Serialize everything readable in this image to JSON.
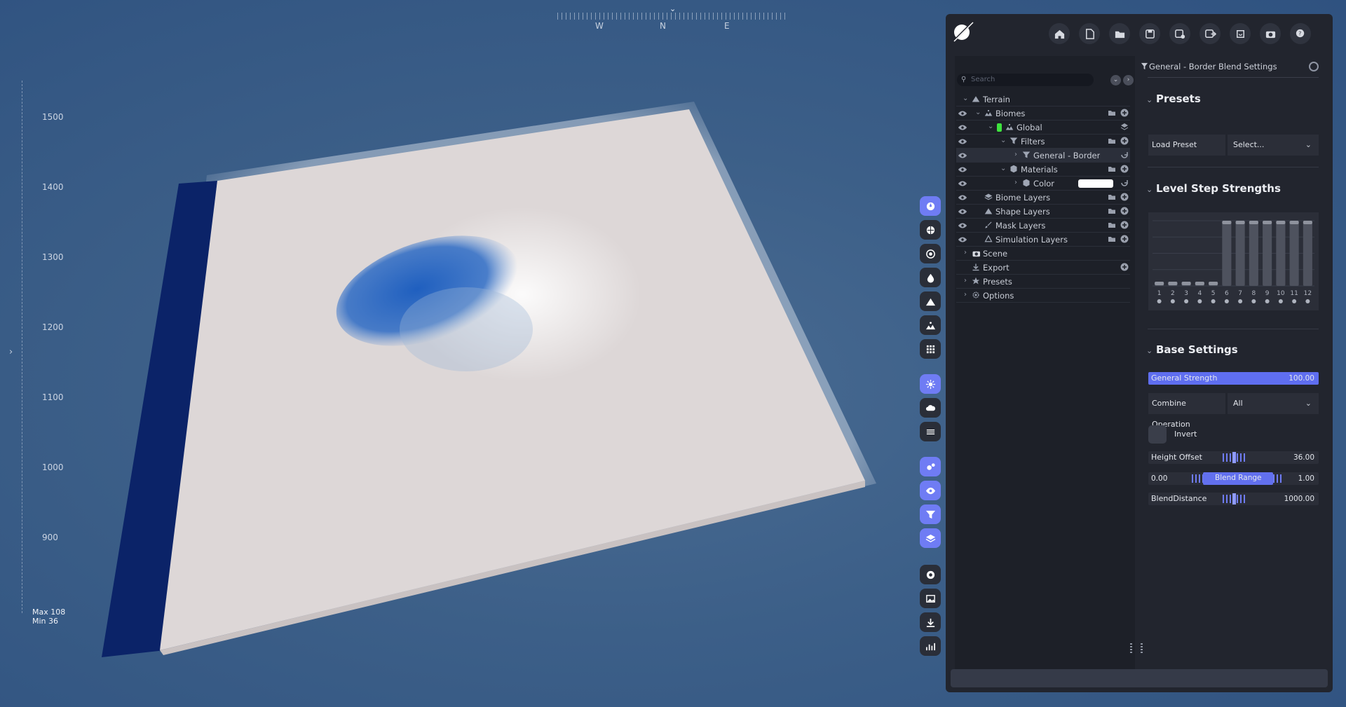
{
  "viewport": {
    "compass": {
      "directions": [
        "W",
        "N",
        "E"
      ]
    },
    "height_ruler": {
      "labels": [
        "1500",
        "1400",
        "1300",
        "1200",
        "1100",
        "1000",
        "900"
      ]
    },
    "height_stats": {
      "max": "Max 108",
      "min": "Min 36"
    }
  },
  "toolstrip": {
    "buttons": [
      {
        "icon": "compass-icon",
        "active": true
      },
      {
        "icon": "globe-icon",
        "active": false
      },
      {
        "icon": "target-icon",
        "active": false
      },
      {
        "icon": "water-drop-icon",
        "active": false
      },
      {
        "icon": "mountain-icon",
        "active": false
      },
      {
        "icon": "landscape-icon",
        "active": false
      },
      {
        "icon": "grid-icon",
        "active": false
      },
      {
        "icon": "sun-icon",
        "active": true
      },
      {
        "icon": "cloud-icon",
        "active": false
      },
      {
        "icon": "wind-icon",
        "active": false
      },
      {
        "icon": "gears-icon",
        "active": true
      },
      {
        "icon": "eye-icon",
        "active": true
      },
      {
        "icon": "filter-icon",
        "active": true
      },
      {
        "icon": "layers-icon",
        "active": true
      },
      {
        "icon": "record-icon",
        "active": false
      },
      {
        "icon": "image-icon",
        "active": false
      },
      {
        "icon": "download-icon",
        "active": false
      },
      {
        "icon": "stats-icon",
        "active": false
      }
    ]
  },
  "header": {
    "buttons": [
      "home-icon",
      "new-file-icon",
      "open-folder-icon",
      "save-icon",
      "save-as-icon",
      "export-file-icon",
      "refresh-icon",
      "camera-icon",
      "help-icon"
    ]
  },
  "tree": {
    "search_placeholder": "Search",
    "rows": [
      {
        "label": "Terrain",
        "icon": "mountain-icon",
        "indent": 0,
        "eye": false,
        "expanded": true
      },
      {
        "label": "Biomes",
        "icon": "landscape-icon",
        "indent": 1,
        "eye": true,
        "expanded": true,
        "actions": [
          "folder",
          "add"
        ]
      },
      {
        "label": "Global",
        "icon": "landscape-icon",
        "indent": 2,
        "eye": true,
        "expanded": true,
        "color_tag": "#3ee23e",
        "actions": [
          "layers"
        ]
      },
      {
        "label": "Filters",
        "icon": "filter-icon",
        "indent": 3,
        "eye": true,
        "expanded": true,
        "actions": [
          "folder",
          "add"
        ]
      },
      {
        "label": "General - Border Blend",
        "icon": "filter-icon",
        "indent": 4,
        "eye": true,
        "expanded": false,
        "selected": true,
        "actions": [
          "refresh"
        ]
      },
      {
        "label": "Materials",
        "icon": "cube-icon",
        "indent": 3,
        "eye": true,
        "expanded": true,
        "actions": [
          "folder",
          "add"
        ]
      },
      {
        "label": "Color",
        "icon": "cube-icon",
        "indent": 4,
        "eye": true,
        "expanded": false,
        "swatch": "#ffffff",
        "actions": [
          "refresh"
        ]
      },
      {
        "label": "Biome Layers",
        "icon": "layers-icon",
        "indent": 1,
        "eye": true,
        "actions": [
          "folder",
          "add"
        ]
      },
      {
        "label": "Shape Layers",
        "icon": "mountain-icon",
        "indent": 1,
        "eye": true,
        "actions": [
          "folder",
          "add"
        ]
      },
      {
        "label": "Mask Layers",
        "icon": "brush-icon",
        "indent": 1,
        "eye": true,
        "actions": [
          "folder",
          "add"
        ]
      },
      {
        "label": "Simulation Layers",
        "icon": "simulation-icon",
        "indent": 1,
        "eye": true,
        "actions": [
          "folder",
          "add"
        ]
      },
      {
        "label": "Scene",
        "icon": "camera-icon",
        "indent": 0,
        "eye": false,
        "expanded": false
      },
      {
        "label": "Export",
        "icon": "download-icon",
        "indent": 0,
        "eye": false,
        "actions": [
          "add"
        ]
      },
      {
        "label": "Presets",
        "icon": "star-icon",
        "indent": 0,
        "eye": false,
        "expanded": false
      },
      {
        "label": "Options",
        "icon": "gear-icon",
        "indent": 0,
        "eye": false,
        "expanded": false
      }
    ]
  },
  "properties": {
    "title": "General - Border Blend Settings",
    "presets": {
      "title": "Presets",
      "load_label": "Load Preset",
      "select_value": "Select..."
    },
    "level_steps": {
      "title": "Level Step Strengths"
    },
    "base": {
      "title": "Base Settings",
      "general_strength": {
        "label": "General Strength",
        "value": "100.00",
        "fraction": 1.0
      },
      "combine": {
        "label": "Combine Operation",
        "value": "All"
      },
      "invert": {
        "label": "Invert",
        "checked": false
      },
      "height_offset": {
        "label": "Height Offset",
        "value": "36.00"
      },
      "blend_range": {
        "label": "Blend Range",
        "min": "0.00",
        "max": "1.00"
      },
      "blend_distance": {
        "label": "BlendDistance",
        "value": "1000.00"
      }
    }
  },
  "colors": {
    "accent": "#6f7cf4",
    "panel_bg": "#22252e",
    "tree_bg": "#1d2028",
    "terrain_top": "#ddd8d8",
    "terrain_shadow": "#0c246e"
  },
  "chart_data": {
    "type": "bar",
    "categories": [
      "1",
      "2",
      "3",
      "4",
      "5",
      "6",
      "7",
      "8",
      "9",
      "10",
      "11",
      "12"
    ],
    "values": [
      0.06,
      0.06,
      0.06,
      0.06,
      0.06,
      1.0,
      1.0,
      1.0,
      1.0,
      1.0,
      1.0,
      1.0
    ],
    "ylim": [
      0,
      1
    ],
    "title": "Level Step Strengths",
    "grid": true
  }
}
